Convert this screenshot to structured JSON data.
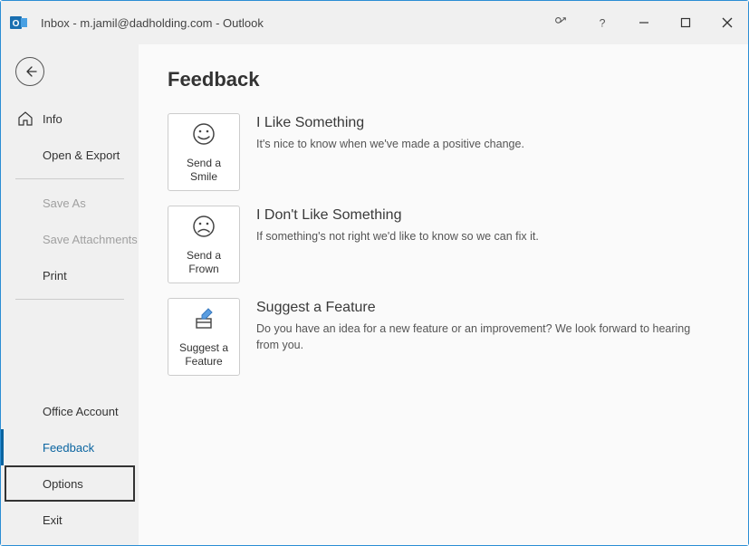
{
  "window": {
    "title": "Inbox - m.jamil@dadholding.com  -  Outlook"
  },
  "sidebar": {
    "info": "Info",
    "open_export": "Open & Export",
    "save_as": "Save As",
    "save_attachments": "Save Attachments",
    "print": "Print",
    "office_account": "Office Account",
    "feedback": "Feedback",
    "options": "Options",
    "exit": "Exit"
  },
  "main": {
    "title": "Feedback",
    "items": [
      {
        "tile": "Send a Smile",
        "heading": "I Like Something",
        "desc": "It's nice to know when we've made a positive change."
      },
      {
        "tile": "Send a Frown",
        "heading": "I Don't Like Something",
        "desc": "If something's not right we'd like to know so we can fix it."
      },
      {
        "tile": "Suggest a Feature",
        "heading": "Suggest a Feature",
        "desc": "Do you have an idea for a new feature or an improvement? We look forward to hearing from you."
      }
    ]
  }
}
